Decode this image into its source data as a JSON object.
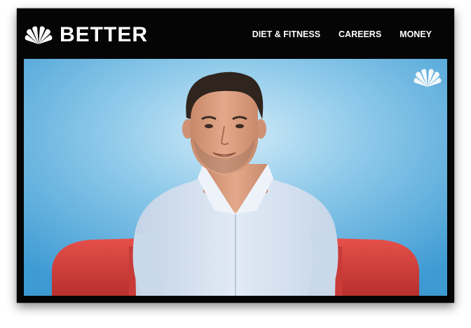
{
  "header": {
    "brand": "BETTER",
    "logo_icon": "nbc-peacock-icon"
  },
  "nav": {
    "items": [
      "DIET & FITNESS",
      "CAREERS",
      "MONEY"
    ]
  },
  "video": {
    "watermark_icon": "nbc-peacock-icon",
    "colors": {
      "background": "#5aaedf",
      "couch": "#d9443f",
      "shirt": "#d6e3f1"
    }
  }
}
